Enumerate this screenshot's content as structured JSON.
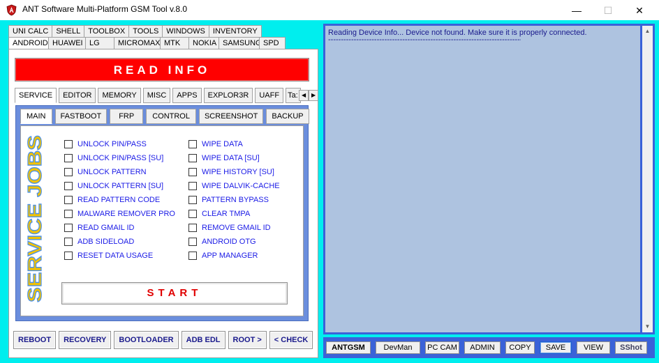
{
  "window": {
    "title": "ANT Software Multi-Platform GSM Tool  v.8.0",
    "minimize": "—",
    "maximize": "☐",
    "close": "✕"
  },
  "top_tabs_row1": [
    "UNI CALC",
    "SHELL",
    "TOOLBOX",
    "TOOLS",
    "WINDOWS",
    "INVENTORY"
  ],
  "top_tabs_row2": [
    "ANDROID",
    "HUAWEI",
    "LG",
    "MICROMAX",
    "MTK",
    "NOKIA",
    "SAMSUNG",
    "SPD"
  ],
  "read_info_label": "READ INFO",
  "android_subtabs": [
    "SERVICE",
    "EDITOR",
    "MEMORY",
    "MISC",
    "APPS",
    "EXPLOR3R",
    "UAFF",
    "Ta:"
  ],
  "service_tabs": [
    "MAIN",
    "FASTBOOT",
    "FRP",
    "CONTROL",
    "SCREENSHOT",
    "BACKUP"
  ],
  "service_jobs_title": "SERVICE JOBS",
  "jobs_left": [
    "UNLOCK PIN/PASS",
    "UNLOCK PIN/PASS [SU]",
    "UNLOCK PATTERN",
    "UNLOCK PATTERN [SU]",
    "READ PATTERN CODE",
    "MALWARE REMOVER PRO",
    "READ GMAIL ID",
    "ADB SIDELOAD",
    "RESET DATA USAGE"
  ],
  "jobs_right": [
    "WIPE DATA",
    "WIPE DATA [SU]",
    "WIPE HISTORY [SU]",
    "WIPE DALVIK-CACHE",
    "PATTERN BYPASS",
    "CLEAR TMPA",
    "REMOVE GMAIL ID",
    "ANDROID OTG",
    "APP MANAGER"
  ],
  "start_label": "START",
  "bottom_buttons": [
    "REBOOT",
    "RECOVERY",
    "BOOTLOADER",
    "ADB EDL",
    "ROOT >",
    "< CHECK"
  ],
  "log": {
    "message": "Reading Device Info... Device not found. Make sure it is properly connected.",
    "separator": "--------------------------------------------------------------------------------------------"
  },
  "right_buttons": [
    "ANTGSM",
    "DevMan",
    "PC CAM",
    "ADMIN",
    "COPY",
    "SAVE",
    "VIEW",
    "SShot"
  ],
  "colors": {
    "frame": "#00eeee",
    "read_info": "#ff0000",
    "service_frame": "#6b8edd",
    "log_bg": "#aec3e0",
    "right_frame": "#3a62d8",
    "job_text": "#1a1ae6",
    "start_text": "#e00000",
    "vertical_title": "#f2c200"
  },
  "icons": {
    "app": "shield-logo-icon",
    "scroll_up": "chevron-up-icon",
    "scroll_down": "chevron-down-icon",
    "tab_left": "chevron-left-icon",
    "tab_right": "chevron-right-icon"
  }
}
